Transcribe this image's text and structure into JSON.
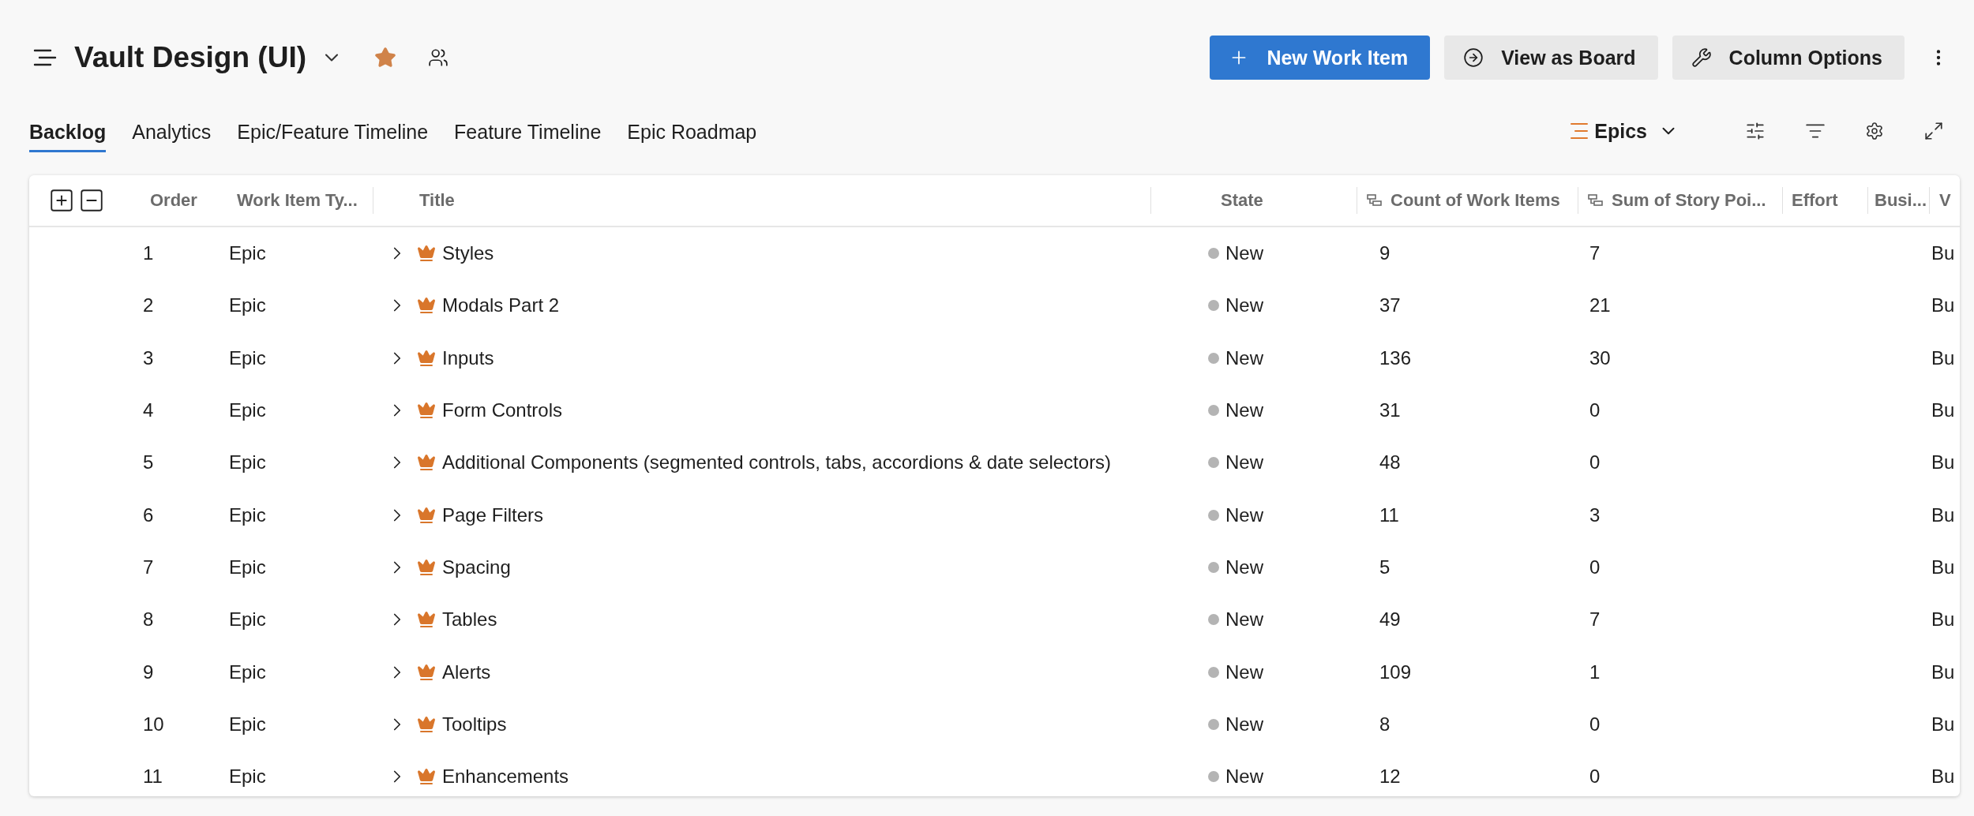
{
  "header": {
    "title": "Vault Design (UI)",
    "favorite": true
  },
  "actions": [
    {
      "label": "New Work Item",
      "kind": "add"
    },
    {
      "label": "View as Board",
      "kind": "board"
    },
    {
      "label": "Column Options",
      "kind": "columns"
    }
  ],
  "tabs": [
    {
      "label": "Backlog",
      "selected": true
    },
    {
      "label": "Analytics",
      "selected": false
    },
    {
      "label": "Epic/Feature Timeline",
      "selected": false
    },
    {
      "label": "Feature Timeline",
      "selected": false
    },
    {
      "label": "Epic Roadmap",
      "selected": false
    }
  ],
  "view_picker": {
    "label": "Epics"
  },
  "table": {
    "columns": [
      "Order",
      "Work Item Ty...",
      "Title",
      "State",
      "Count of Work Items",
      "Sum of Story Poi...",
      "Effort",
      "Busi...",
      "V"
    ],
    "rows": [
      {
        "order": "1",
        "type": "Epic",
        "title": "Styles",
        "state": "New",
        "count": "9",
        "sum": "7",
        "column_9": "Bu",
        "expanded": false
      },
      {
        "order": "2",
        "type": "Epic",
        "title": "Modals Part 2",
        "state": "New",
        "count": "37",
        "sum": "21",
        "column_9": "Bu",
        "expanded": false
      },
      {
        "order": "3",
        "type": "Epic",
        "title": "Inputs",
        "state": "New",
        "count": "136",
        "sum": "30",
        "column_9": "Bu",
        "expanded": false
      },
      {
        "order": "4",
        "type": "Epic",
        "title": "Form Controls",
        "state": "New",
        "count": "31",
        "sum": "0",
        "column_9": "Bu",
        "expanded": false
      },
      {
        "order": "5",
        "type": "Epic",
        "title": "Additional Components (segmented controls, tabs, accordions & date selectors)",
        "state": "New",
        "count": "48",
        "sum": "0",
        "column_9": "Bu",
        "expanded": false
      },
      {
        "order": "6",
        "type": "Epic",
        "title": "Page Filters",
        "state": "New",
        "count": "11",
        "sum": "3",
        "column_9": "Bu",
        "expanded": false
      },
      {
        "order": "7",
        "type": "Epic",
        "title": "Spacing",
        "state": "New",
        "count": "5",
        "sum": "0",
        "column_9": "Bu",
        "expanded": false
      },
      {
        "order": "8",
        "type": "Epic",
        "title": "Tables",
        "state": "New",
        "count": "49",
        "sum": "7",
        "column_9": "Bu",
        "expanded": false
      },
      {
        "order": "9",
        "type": "Epic",
        "title": "Alerts",
        "state": "New",
        "count": "109",
        "sum": "1",
        "column_9": "Bu",
        "expanded": false
      },
      {
        "order": "10",
        "type": "Epic",
        "title": "Tooltips",
        "state": "New",
        "count": "8",
        "sum": "0",
        "column_9": "Bu",
        "expanded": false
      },
      {
        "order": "11",
        "type": "Epic",
        "title": "Enhancements",
        "state": "New",
        "count": "12",
        "sum": "0",
        "column_9": "Bu",
        "expanded": false
      }
    ]
  }
}
